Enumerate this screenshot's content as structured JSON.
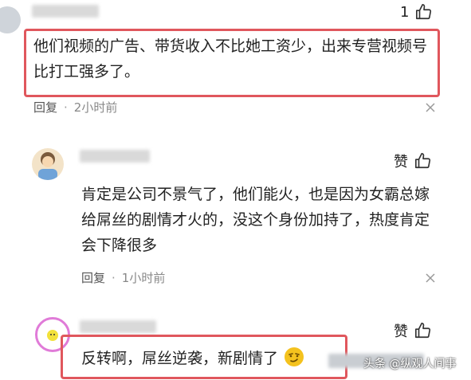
{
  "comments": [
    {
      "like_count": "1",
      "text": "他们视频的广告、带货收入不比她工资少，出来专营视频号比打工强多了。",
      "reply_label": "回复",
      "time": "2小时前"
    },
    {
      "like_label": "赞",
      "text": "肯定是公司不景气了，他们能火，也是因为女霸总嫁给屌丝的剧情才火的，没这个身份加持了，热度肯定会下降很多",
      "reply_label": "回复",
      "time": "1小时前"
    },
    {
      "like_label": "赞",
      "text": "反转啊，屌丝逆袭，新剧情了"
    }
  ],
  "watermark": "头条 @纵观人间事",
  "colors": {
    "highlight": "#e0575d"
  }
}
